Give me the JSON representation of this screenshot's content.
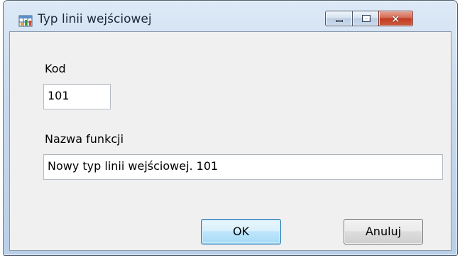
{
  "window": {
    "title": "Typ linii wejściowej",
    "icon": "app-table-icon",
    "controls": {
      "minimize_icon": "minimize-icon",
      "maximize_icon": "maximize-icon",
      "close_icon": "close-icon",
      "close_glyph": "✕"
    }
  },
  "form": {
    "code": {
      "label": "Kod",
      "value": "101"
    },
    "function_name": {
      "label": "Nazwa funkcji",
      "value": "Nowy typ linii wejściowej. 101"
    }
  },
  "buttons": {
    "ok_label": "OK",
    "cancel_label": "Anuluj"
  },
  "colors": {
    "frame": "#c7d9ee",
    "client": "#f0f0f0",
    "close_button": "#c13b21",
    "default_button_border": "#3c7fb1"
  }
}
